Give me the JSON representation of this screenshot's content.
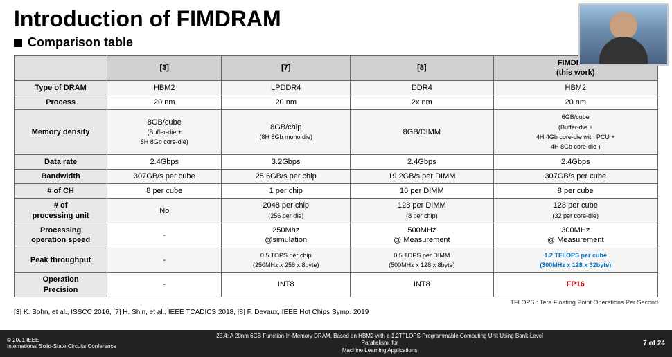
{
  "slide": {
    "title": "Introduction of FIMDRAM",
    "subtitle": "Comparison table",
    "table": {
      "headers": [
        "",
        "[3]",
        "[7]",
        "[8]",
        "FIMDRAM\n(this work)"
      ],
      "rows": [
        {
          "label": "Type of DRAM",
          "col3": "HBM2",
          "col7": "LPDDR4",
          "col8": "DDR4",
          "colF": "HBM2"
        },
        {
          "label": "Process",
          "col3": "20 nm",
          "col7": "20 nm",
          "col8": "2x nm",
          "colF": "20 nm"
        },
        {
          "label": "Memory density",
          "col3": "8GB/cube\n(Buffer-die +\n8H 8Gb core-die)",
          "col7": "8GB/chip\n(8H 8Gb mono die)",
          "col8": "8GB/DIMM",
          "colF": "6GB/cube\n(Buffer-die +\n4H 4Gb core-die with PCU +\n4H 8Gb core-die )"
        },
        {
          "label": "Data rate",
          "col3": "2.4Gbps",
          "col7": "3.2Gbps",
          "col8": "2.4Gbps",
          "colF": "2.4Gbps"
        },
        {
          "label": "Bandwidth",
          "col3": "307GB/s per cube",
          "col7": "25.6GB/s per chip",
          "col8": "19.2GB/s per DIMM",
          "colF": "307GB/s per cube"
        },
        {
          "label": "# of CH",
          "col3": "8 per cube",
          "col7": "1 per chip",
          "col8": "16 per DIMM",
          "colF": "8 per cube"
        },
        {
          "label": "# of\nprocessing unit",
          "col3": "No",
          "col7": "2048 per chip\n(256 per die)",
          "col8": "128 per DIMM\n(8 per chip)",
          "colF": "128 per cube\n(32 per core-die)"
        },
        {
          "label": "Processing\noperation speed",
          "col3": "-",
          "col7": "250Mhz\n@simulation",
          "col8": "500MHz\n@ Measurement",
          "colF": "300MHz\n@ Measurement"
        },
        {
          "label": "Peak throughput",
          "col3": "-",
          "col7": "0.5 TOPS per chip\n(250MHz x 256 x 8byte)",
          "col8": "0.5 TOPS per DIMM\n(500MHz x 128 x 8byte)",
          "colF_highlight": "1.2 TFLOPS per cube\n(300MHz x 128 x 32byte)",
          "colF_color": "blue"
        },
        {
          "label": "Operation\nPrecision",
          "col3": "-",
          "col7": "INT8",
          "col8": "INT8",
          "colF_highlight": "FP16",
          "colF_color": "red"
        }
      ]
    },
    "tflops_note": "TFLOPS : Tera Floating Point Operations Per Second",
    "references": "[3] K. Sohn, et al., ISSCC 2016, [7] H. Shin, et al., IEEE TCADICS 2018, [8] F. Devaux, IEEE Hot Chips Symp. 2019",
    "bottom": {
      "left_line1": "© 2021 IEEE",
      "left_line2": "International Solid-State Circuits Conference",
      "center": "25.4: A 20nm 6GB Function-In-Memory DRAM, Based on HBM2 with a 1.2TFLOPS Programmable Computing Unit Using Bank-Level Parallelism, for\nMachine Learning Applications",
      "right": "7 of 24"
    }
  }
}
